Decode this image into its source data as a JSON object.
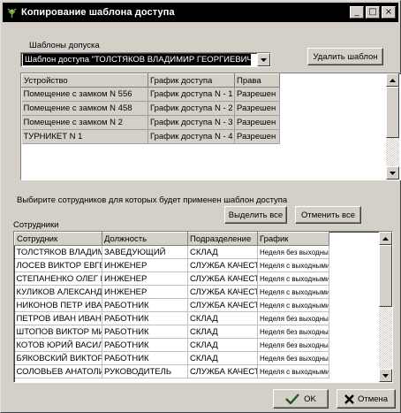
{
  "window": {
    "title": "Копирование шаблона доступа",
    "min_glyph": "_",
    "max_glyph": "□",
    "close_glyph": "×"
  },
  "templates": {
    "label": "Шаблоны допуска",
    "selected": "Шаблон доступа \"ТОЛСТЯКОВ ВЛАДИМИР ГЕОРГИЕВИЧ\"",
    "delete_button": "Удалить шаблон",
    "columns": [
      "Устройство",
      "График доступа",
      "Права"
    ],
    "rows": [
      [
        "Помещение с замком N 556",
        "График доступа N - 1",
        "Разрешен"
      ],
      [
        "Помещение с замком N 458",
        "График доступа N - 2",
        "Разрешен"
      ],
      [
        "Помещение с замком N 2",
        "График доступа N - 3",
        "Разрешен"
      ],
      [
        "ТУРНИКЕТ N 1",
        "График доступа N - 4",
        "Разрешен"
      ]
    ]
  },
  "employees": {
    "instruction": "Выбирите сотрудников для которых будет применен шаблон доступа",
    "label": "Сотрудники",
    "select_all": "Выделить все",
    "deselect_all": "Отменить все",
    "columns": [
      "Сотрудник",
      "Должность",
      "Подразделение",
      "График"
    ],
    "rows": [
      [
        "ТОЛСТЯКОВ ВЛАДИМИР",
        "ЗАВЕДУЮЩИЙ",
        "СКЛАД",
        "Неделя без выходных"
      ],
      [
        "ЛОСЕВ ВИКТОР ЕВГЕНЬЕВ",
        "ИНЖЕНЕР",
        "СЛУЖБА КАЧЕСТВА",
        "Неделя с выходными"
      ],
      [
        "СТЕПАНЕНКО ОЛЕГ ЕВГ",
        "ИНЖЕНЕР",
        "СЛУЖБА КАЧЕСТВА",
        "Неделя с выходными"
      ],
      [
        "КУЛИКОВ АЛЕКСАНДР",
        "ИНЖЕНЕР",
        "СЛУЖБА КАЧЕСТВА",
        "Неделя с выходными"
      ],
      [
        "НИКОНОВ ПЕТР ИВАНОВ",
        "РАБОТНИК",
        "СЛУЖБА КАЧЕСТВА",
        "Неделя с выходными"
      ],
      [
        "ПЕТРОВ ИВАН ИВАНОВИЧ",
        "РАБОТНИК",
        "СКЛАД",
        "Неделя без выходных"
      ],
      [
        "ШТОПОВ ВИКТОР МИХАЙ",
        "РАБОТНИК",
        "СКЛАД",
        "Неделя без выходных"
      ],
      [
        "КОТОВ ЮРИЙ ВАСИЛЬЕВИЧ",
        "РАБОТНИК",
        "СКЛАД",
        "Неделя без выходных"
      ],
      [
        "БЯКОВСКИЙ ВИКТОР",
        "РАБОТНИК",
        "СКЛАД",
        "Неделя без выходных"
      ],
      [
        "СОЛОВЬЕВ АНАТОЛИЙ",
        "РУКОВОДИТЕЛЬ",
        "СЛУЖБА КАЧЕСТВА",
        "Неделя с выходными"
      ]
    ]
  },
  "footer": {
    "ok": "OK",
    "cancel": "Отмена"
  },
  "colors": {
    "face": "#d4d0c8",
    "titlebar": "#000000",
    "ok_check": "#1a5c1a",
    "cancel_x": "#000000"
  }
}
